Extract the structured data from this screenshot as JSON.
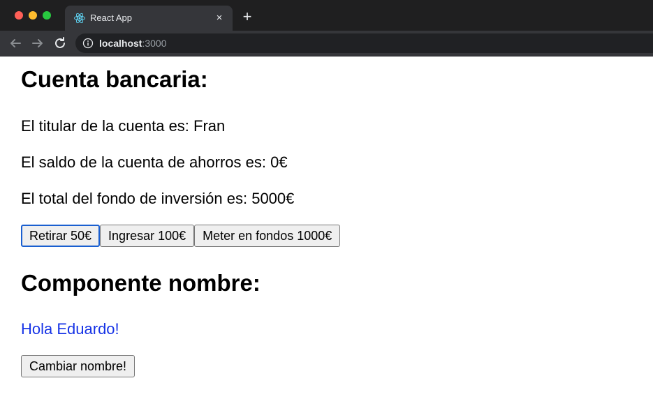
{
  "browser": {
    "tab_title": "React App",
    "tab_icon": "react-logo-icon",
    "url_host": "localhost",
    "url_port": ":3000",
    "close_glyph": "×",
    "new_tab_glyph": "+"
  },
  "cuenta": {
    "title": "Cuenta bancaria:",
    "titular": "El titular de la cuenta es: Fran",
    "saldo": "El saldo de la cuenta de ahorros es: 0€",
    "fondo": "El total del fondo de inversión es: 5000€",
    "buttons": {
      "retirar": "Retirar 50€",
      "ingresar": "Ingresar 100€",
      "meter": "Meter en fondos 1000€"
    }
  },
  "componente": {
    "title": "Componente nombre:",
    "greeting": "Hola Eduardo!",
    "greeting_color": "#1633e6",
    "button": "Cambiar nombre!"
  },
  "colors": {
    "focus_ring": "#1a5fd0",
    "tabstrip_bg": "#1f1f20",
    "toolbar_bg": "#35363a"
  }
}
